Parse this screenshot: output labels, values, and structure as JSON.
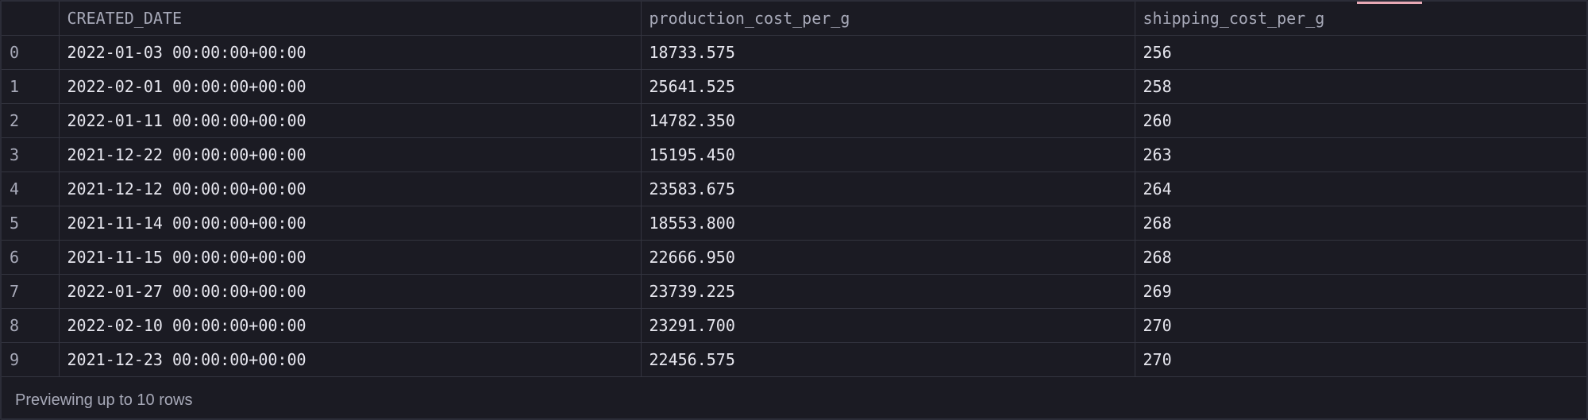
{
  "table": {
    "columns": [
      "",
      "CREATED_DATE",
      "production_cost_per_g",
      "shipping_cost_per_g"
    ],
    "rows": [
      [
        "0",
        "2022-01-03 00:00:00+00:00",
        "18733.575",
        "256"
      ],
      [
        "1",
        "2022-02-01 00:00:00+00:00",
        "25641.525",
        "258"
      ],
      [
        "2",
        "2022-01-11 00:00:00+00:00",
        "14782.350",
        "260"
      ],
      [
        "3",
        "2021-12-22 00:00:00+00:00",
        "15195.450",
        "263"
      ],
      [
        "4",
        "2021-12-12 00:00:00+00:00",
        "23583.675",
        "264"
      ],
      [
        "5",
        "2021-11-14 00:00:00+00:00",
        "18553.800",
        "268"
      ],
      [
        "6",
        "2021-11-15 00:00:00+00:00",
        "22666.950",
        "268"
      ],
      [
        "7",
        "2022-01-27 00:00:00+00:00",
        "23739.225",
        "269"
      ],
      [
        "8",
        "2022-02-10 00:00:00+00:00",
        "23291.700",
        "270"
      ],
      [
        "9",
        "2021-12-23 00:00:00+00:00",
        "22456.575",
        "270"
      ]
    ]
  },
  "footer": {
    "text": "Previewing up to 10 rows"
  },
  "colors": {
    "background": "#1b1b23",
    "grid_line": "#33343f",
    "text": "#e6e6ee",
    "muted_text": "#a7a9b8",
    "accent": "#e8a9b5"
  }
}
